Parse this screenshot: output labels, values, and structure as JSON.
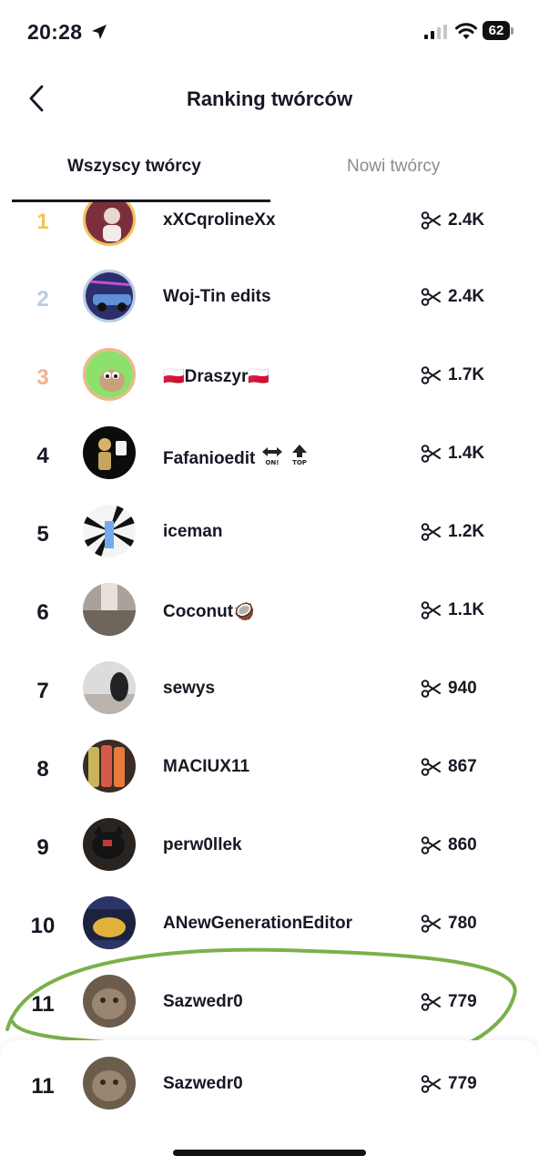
{
  "status_bar": {
    "time": "20:28",
    "battery": "62"
  },
  "header": {
    "title": "Ranking twórców"
  },
  "tabs": [
    {
      "label": "Wszyscy twórcy",
      "active": true
    },
    {
      "label": "Nowi twórcy",
      "active": false
    }
  ],
  "rows": [
    {
      "rank": "1",
      "name": "xXCqrolineXx",
      "count": "2.4K"
    },
    {
      "rank": "2",
      "name": "Woj-Tin edits",
      "count": "2.4K"
    },
    {
      "rank": "3",
      "name": "🇵🇱Draszyr🇵🇱",
      "count": "1.7K"
    },
    {
      "rank": "4",
      "name": "Fafanioedit",
      "count": "1.4K"
    },
    {
      "rank": "5",
      "name": "iceman",
      "count": "1.2K"
    },
    {
      "rank": "6",
      "name": "Coconut🥥",
      "count": "1.1K"
    },
    {
      "rank": "7",
      "name": "sewys",
      "count": "940"
    },
    {
      "rank": "8",
      "name": "MACIUX11",
      "count": "867"
    },
    {
      "rank": "9",
      "name": "perw0llek",
      "count": "860"
    },
    {
      "rank": "10",
      "name": "ANewGenerationEditor",
      "count": "780"
    },
    {
      "rank": "11",
      "name": "Sazwedr0",
      "count": "779"
    }
  ],
  "my_rank": {
    "rank": "11",
    "name": "Sazwedr0",
    "count": "779"
  },
  "icons": {
    "count_icon": "scissors-icon",
    "back_icon": "chevron-left-icon"
  },
  "colors": {
    "gold": "#f4c15a",
    "silver": "#b8cde3",
    "bronze": "#f0b48c",
    "annotation": "#7bb04a"
  }
}
